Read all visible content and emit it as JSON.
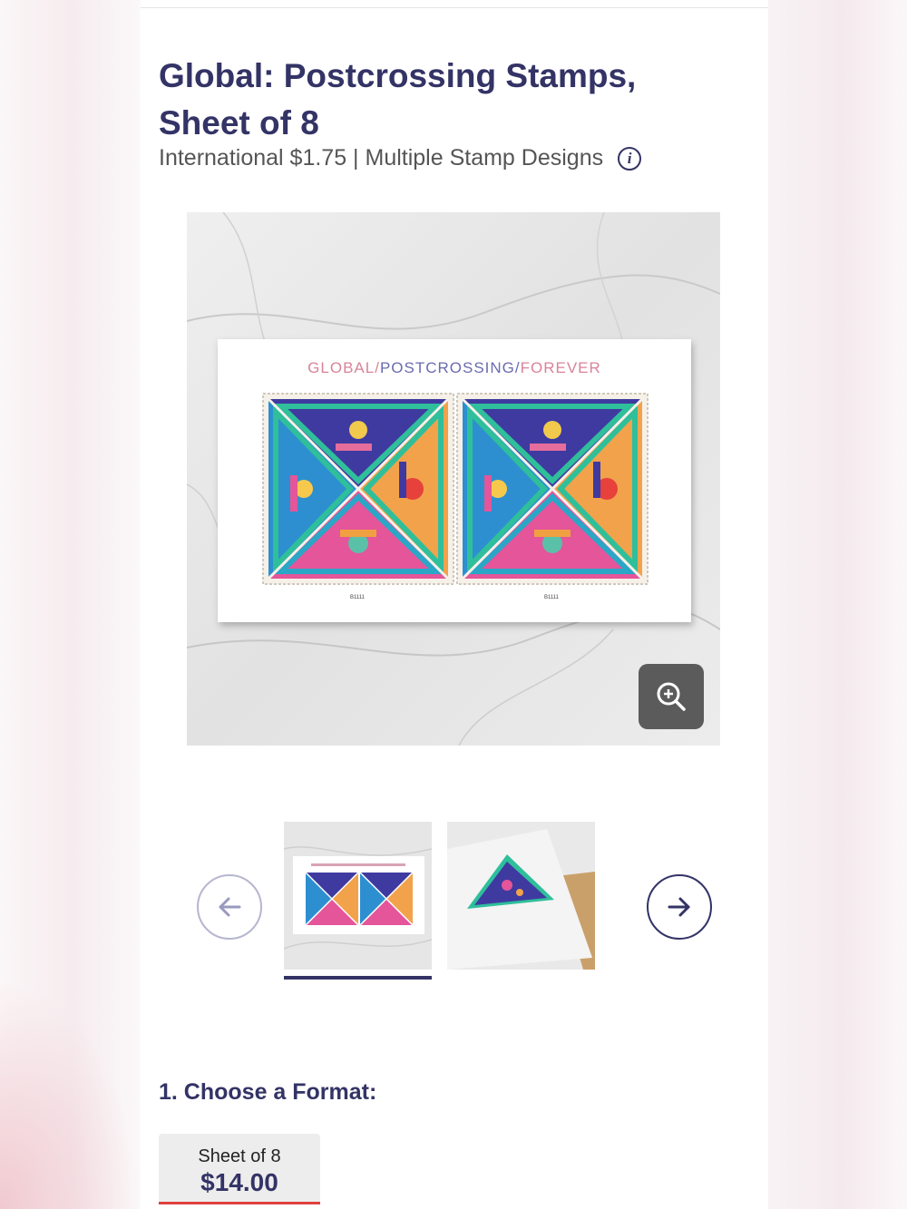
{
  "product": {
    "title": "Global: Postcrossing Stamps, Sheet of 8",
    "subtitle": "International $1.75 | Multiple Stamp Designs"
  },
  "hero_image": {
    "sheet_heading_parts": [
      "GLOBAL/",
      "POSTCROSSING/",
      "FOREVER"
    ],
    "plate_numbers": [
      "B1111",
      "B1111"
    ]
  },
  "icons": {
    "info": "info-icon",
    "zoom": "zoom-in-icon",
    "prev": "arrow-left-icon",
    "next": "arrow-right-icon"
  },
  "thumbnails": {
    "selected_index": 0,
    "count": 2
  },
  "format_section": {
    "label": "1. Choose a Format:",
    "options": [
      {
        "name": "Sheet of 8",
        "price": "$14.00",
        "selected": true
      }
    ]
  },
  "colors": {
    "brand_navy": "#333366",
    "accent_red": "#e0403f",
    "heading_pink": "#d9839b",
    "heading_purple": "#6b6bb0"
  }
}
